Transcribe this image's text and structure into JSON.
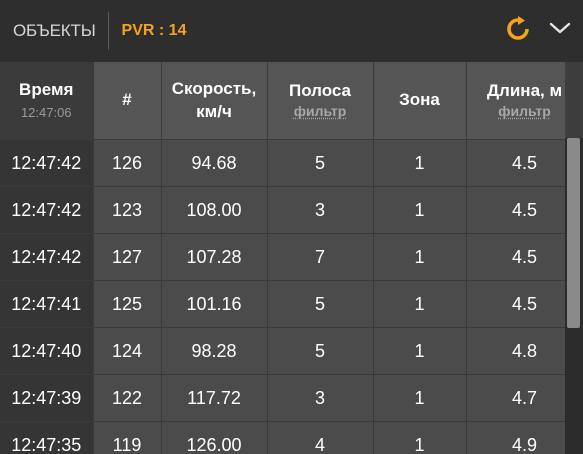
{
  "header": {
    "title": "ОБЪЕКТЫ",
    "pvr_label": "PVR : 14",
    "accent_color": "#f5a31a",
    "refresh_icon": "refresh-icon",
    "collapse_icon": "chevron-down-icon"
  },
  "table": {
    "columns": {
      "time": {
        "label": "Время",
        "sub": "12:47:06"
      },
      "num": {
        "label": "#"
      },
      "speed": {
        "label": "Скорость, км/ч"
      },
      "lane": {
        "label": "Полоса",
        "filter": "фильтр"
      },
      "zone": {
        "label": "Зона"
      },
      "length": {
        "label": "Длина, м",
        "filter": "фильтр"
      }
    },
    "rows": [
      {
        "time": "12:47:42",
        "num": "126",
        "speed": "94.68",
        "lane": "5",
        "zone": "1",
        "length": "4.5"
      },
      {
        "time": "12:47:42",
        "num": "123",
        "speed": "108.00",
        "lane": "3",
        "zone": "1",
        "length": "4.5"
      },
      {
        "time": "12:47:42",
        "num": "127",
        "speed": "107.28",
        "lane": "7",
        "zone": "1",
        "length": "4.5"
      },
      {
        "time": "12:47:41",
        "num": "125",
        "speed": "101.16",
        "lane": "5",
        "zone": "1",
        "length": "4.5"
      },
      {
        "time": "12:47:40",
        "num": "124",
        "speed": "98.28",
        "lane": "5",
        "zone": "1",
        "length": "4.8"
      },
      {
        "time": "12:47:39",
        "num": "122",
        "speed": "117.72",
        "lane": "3",
        "zone": "1",
        "length": "4.7"
      },
      {
        "time": "12:47:35",
        "num": "119",
        "speed": "126.00",
        "lane": "4",
        "zone": "1",
        "length": "4.9"
      }
    ]
  }
}
